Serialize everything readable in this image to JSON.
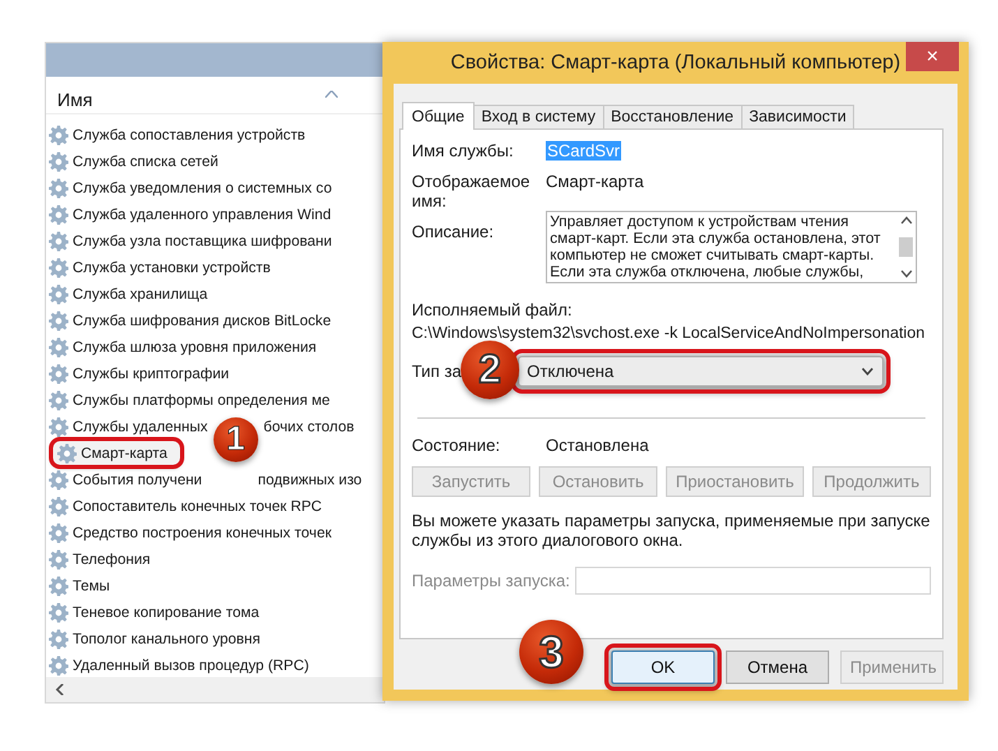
{
  "services_list": {
    "column_header": "Имя",
    "items": [
      {
        "name": "Служба сопоставления устройств",
        "highlighted": false
      },
      {
        "name": "Служба списка сетей",
        "highlighted": false
      },
      {
        "name": "Служба уведомления о системных со",
        "highlighted": false
      },
      {
        "name": "Служба удаленного управления Wind",
        "highlighted": false
      },
      {
        "name": "Служба узла поставщика шифровани",
        "highlighted": false
      },
      {
        "name": "Служба установки устройств",
        "highlighted": false
      },
      {
        "name": "Служба хранилища",
        "highlighted": false
      },
      {
        "name": "Служба шифрования дисков BitLocke",
        "highlighted": false
      },
      {
        "name": "Служба шлюза уровня приложения",
        "highlighted": false
      },
      {
        "name": "Службы криптографии",
        "highlighted": false
      },
      {
        "name": "Службы платформы определения ме",
        "highlighted": false
      },
      {
        "name": "Службы удаленных",
        "tail": "бочих столов",
        "highlighted": false
      },
      {
        "name": "Смарт-карта",
        "highlighted": true
      },
      {
        "name": "События получени",
        "tail": "подвижных изо",
        "highlighted": false
      },
      {
        "name": "Сопоставитель конечных точек RPC",
        "highlighted": false
      },
      {
        "name": "Средство построения конечных точек",
        "highlighted": false
      },
      {
        "name": "Телефония",
        "highlighted": false
      },
      {
        "name": "Темы",
        "highlighted": false
      },
      {
        "name": "Теневое копирование тома",
        "highlighted": false
      },
      {
        "name": "Тополог канального уровня",
        "highlighted": false
      },
      {
        "name": "Удаленный вызов процедур (RPC)",
        "highlighted": false
      }
    ]
  },
  "dialog": {
    "title": "Свойства: Смарт-карта (Локальный компьютер)",
    "close": "×",
    "tabs": [
      {
        "label": "Общие",
        "selected": true
      },
      {
        "label": "Вход в систему",
        "selected": false
      },
      {
        "label": "Восстановление",
        "selected": false
      },
      {
        "label": "Зависимости",
        "selected": false
      }
    ],
    "service_name_label": "Имя службы:",
    "service_name": "SCardSvr",
    "display_name_label": "Отображаемое имя:",
    "display_name": "Смарт-карта",
    "description_label": "Описание:",
    "description": "Управляет доступом к устройствам чтения смарт-карт. Если эта служба остановлена, этот компьютер не сможет считывать смарт-карты. Если эта служба отключена, любые службы,",
    "executable_label": "Исполняемый файл:",
    "executable": "C:\\Windows\\system32\\svchost.exe -k LocalServiceAndNoImpersonation",
    "startup_type_label": "Тип за",
    "startup_type": "Отключена",
    "startup_highlighted": true,
    "status_label": "Состояние:",
    "status": "Остановлена",
    "service_buttons": [
      {
        "label": "Запустить",
        "disabled": true
      },
      {
        "label": "Остановить",
        "disabled": true
      },
      {
        "label": "Приостановить",
        "disabled": true
      },
      {
        "label": "Продолжить",
        "disabled": true
      }
    ],
    "hint": "Вы можете указать параметры запуска, применяемые при запуске службы из этого диалогового окна.",
    "start_params_label": "Параметры запуска:",
    "buttons": [
      {
        "label": "OK",
        "disabled": false,
        "highlighted": true
      },
      {
        "label": "Отмена",
        "disabled": false,
        "highlighted": false
      },
      {
        "label": "Применить",
        "disabled": true,
        "highlighted": false
      }
    ]
  },
  "step_badges": [
    "1",
    "2",
    "3"
  ]
}
